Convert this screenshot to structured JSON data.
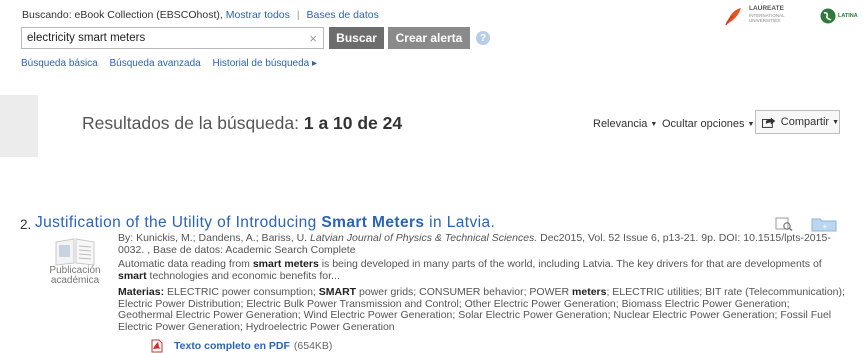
{
  "header": {
    "prefix": "Buscando:",
    "database": "eBook Collection (EBSCOhost),",
    "show_all": "Mostrar todos",
    "databases_link": "Bases de datos"
  },
  "search": {
    "value": "electricity smart meters",
    "clear_glyph": "×",
    "search_button": "Buscar",
    "alert_button": "Crear alerta",
    "help_glyph": "?"
  },
  "subnav": {
    "basic": "Búsqueda básica",
    "advanced": "Búsqueda avanzada",
    "history": "Historial de búsqueda ▸"
  },
  "logos": {
    "laureate_name": "LAUREATE",
    "laureate_sub1": "INTERNATIONAL",
    "laureate_sub2": "UNIVERSITIES",
    "latina_name": "LATINA"
  },
  "results": {
    "label": "Resultados de la búsqueda:",
    "range": "1 a 10 de 24",
    "relevance": "Relevancia",
    "hide_options": "Ocultar opciones",
    "share": "Compartir"
  },
  "result_item": {
    "number": "2.",
    "title_part1": "Justification of the Utility of Introducing ",
    "title_bold": "Smart Meters",
    "title_part2": " in Latvia.",
    "by": "By: Kunickis, M.; Dandens, A.; Bariss, U. ",
    "journal": "Latvian Journal of Physics & Technical Sciences.",
    "citation": " Dec2015, Vol. 52 Issue 6, p13-21. 9p. DOI: 10.1515/lpts-2015-0032. , Base de datos: Academic Search Complete",
    "abstract_1": "Automatic data reading from ",
    "abstract_b1": "smart meters",
    "abstract_2": " is being developed in many parts of the world, including Latvia. The key drivers for that are developments of ",
    "abstract_b2": "smart",
    "abstract_3": " technologies and economic benefits for...",
    "subjects_label": "Materias:",
    "subjects_1": " ELECTRIC power consumption; ",
    "subjects_b1": "SMART",
    "subjects_2": " power grids; CONSUMER behavior; POWER ",
    "subjects_b2": "meters",
    "subjects_3": "; ELECTRIC utilities; BIT rate (Telecommunication); Electric Power Distribution; Electric Bulk Power Transmission and Control; Other Electric Power Generation; Biomass Electric Power Generation; Geothermal Electric Power Generation; Wind Electric Power Generation; Solar Electric Power Generation; Nuclear Electric Power Generation; Fossil Fuel Electric Power Generation; Hydroelectric Power Generation",
    "pub_type_1": "Publicación",
    "pub_type_2": "académica",
    "pdf_link": "Texto completo en PDF",
    "pdf_size": "(654KB)"
  },
  "colors": {
    "link": "#2a63b8",
    "button_dark": "#6d6d6d",
    "button_light": "#8a8a8a",
    "laureate_orange": "#e8561f",
    "latina_green": "#2f7a3b"
  },
  "icons": [
    "clear-icon",
    "help-icon",
    "share-icon",
    "preview-icon",
    "folder-icon",
    "document-thumbnail-icon",
    "pdf-icon"
  ]
}
